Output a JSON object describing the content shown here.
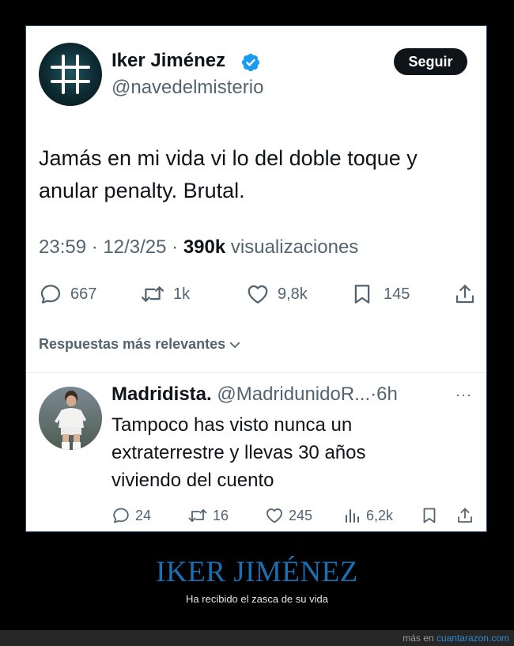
{
  "tweet": {
    "author_name": "Iker Jiménez",
    "handle": "@navedelmisterio",
    "follow_label": "Seguir",
    "text_line1": "Jamás en mi vida vi lo del doble toque y",
    "text_line2": "anular penalty. Brutal.",
    "time": "23:59",
    "sep": "·",
    "date": "12/3/25",
    "views_count": "390k",
    "views_label": "visualizaciones",
    "replies": "667",
    "retweets": "1k",
    "likes": "9,8k",
    "bookmarks": "145"
  },
  "replies_section": {
    "label": "Respuestas más relevantes"
  },
  "reply": {
    "name": "Madridista.",
    "handle": "@MadridunidoR...",
    "sep": "·",
    "time": "6h",
    "more": "···",
    "text_line1": "Tampoco has visto nunca un",
    "text_line2": "extraterrestre y llevas 30 años",
    "text_line3": "viviendo del cuento",
    "replies": "24",
    "retweets": "16",
    "likes": "245",
    "views": "6,2k"
  },
  "caption": {
    "title": "IKER JIMÉNEZ",
    "subtitle": "Ha recibido el zasca de su vida"
  },
  "footer": {
    "prefix": "más en",
    "site": "cuantarazon.com"
  },
  "colors": {
    "verified": "#1d9bf0",
    "caption_title": "#1a6fb0",
    "footer_link": "#2f8ad0"
  }
}
